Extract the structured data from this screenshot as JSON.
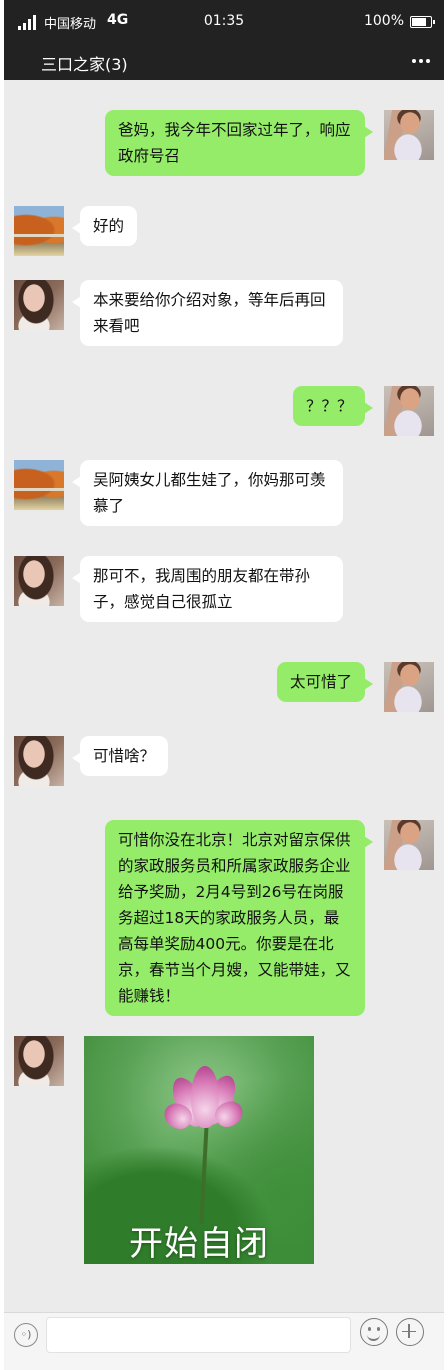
{
  "status_bar": {
    "carrier": "中国移动",
    "network": "4G",
    "time": "01:35",
    "battery": "100%"
  },
  "header": {
    "title": "三口之家(3)",
    "more_icon": "more-dots-icon"
  },
  "messages": [
    {
      "sender": "me",
      "avatar": "boy",
      "text": "爸妈，我今年不回家过年了，响应政府号召"
    },
    {
      "sender": "dad",
      "avatar": "autumn-trees",
      "text": "好的"
    },
    {
      "sender": "mom",
      "avatar": "lady",
      "text": "本来要给你介绍对象，等年后再回来看吧"
    },
    {
      "sender": "me",
      "avatar": "boy",
      "text": "？？？"
    },
    {
      "sender": "dad",
      "avatar": "autumn-trees",
      "text": "吴阿姨女儿都生娃了，你妈那可羡慕了"
    },
    {
      "sender": "mom",
      "avatar": "lady",
      "text": "那可不，我周围的朋友都在带孙子，感觉自己很孤立"
    },
    {
      "sender": "me",
      "avatar": "boy",
      "text": "太可惜了"
    },
    {
      "sender": "mom",
      "avatar": "lady",
      "text": "可惜啥？"
    },
    {
      "sender": "me",
      "avatar": "boy",
      "text": "可惜你没在北京！北京对留京保供的家政服务员和所属家政服务企业给予奖励，2月4号到26号在岗服务超过18天的家政服务人员，最高每单奖励400元。你要是在北京，春节当个月嫂，又能带娃，又能赚钱！"
    },
    {
      "sender": "mom",
      "avatar": "lady",
      "type": "sticker",
      "text": "开始自闭"
    }
  ],
  "input_bar": {
    "voice_icon": "voice-icon",
    "emoji_icon": "emoji-icon",
    "plus_icon": "plus-icon",
    "value": ""
  },
  "colors": {
    "bar": "#222222",
    "chat_bg": "#ebebeb",
    "my_bubble": "#95ec69",
    "other_bubble": "#ffffff"
  }
}
